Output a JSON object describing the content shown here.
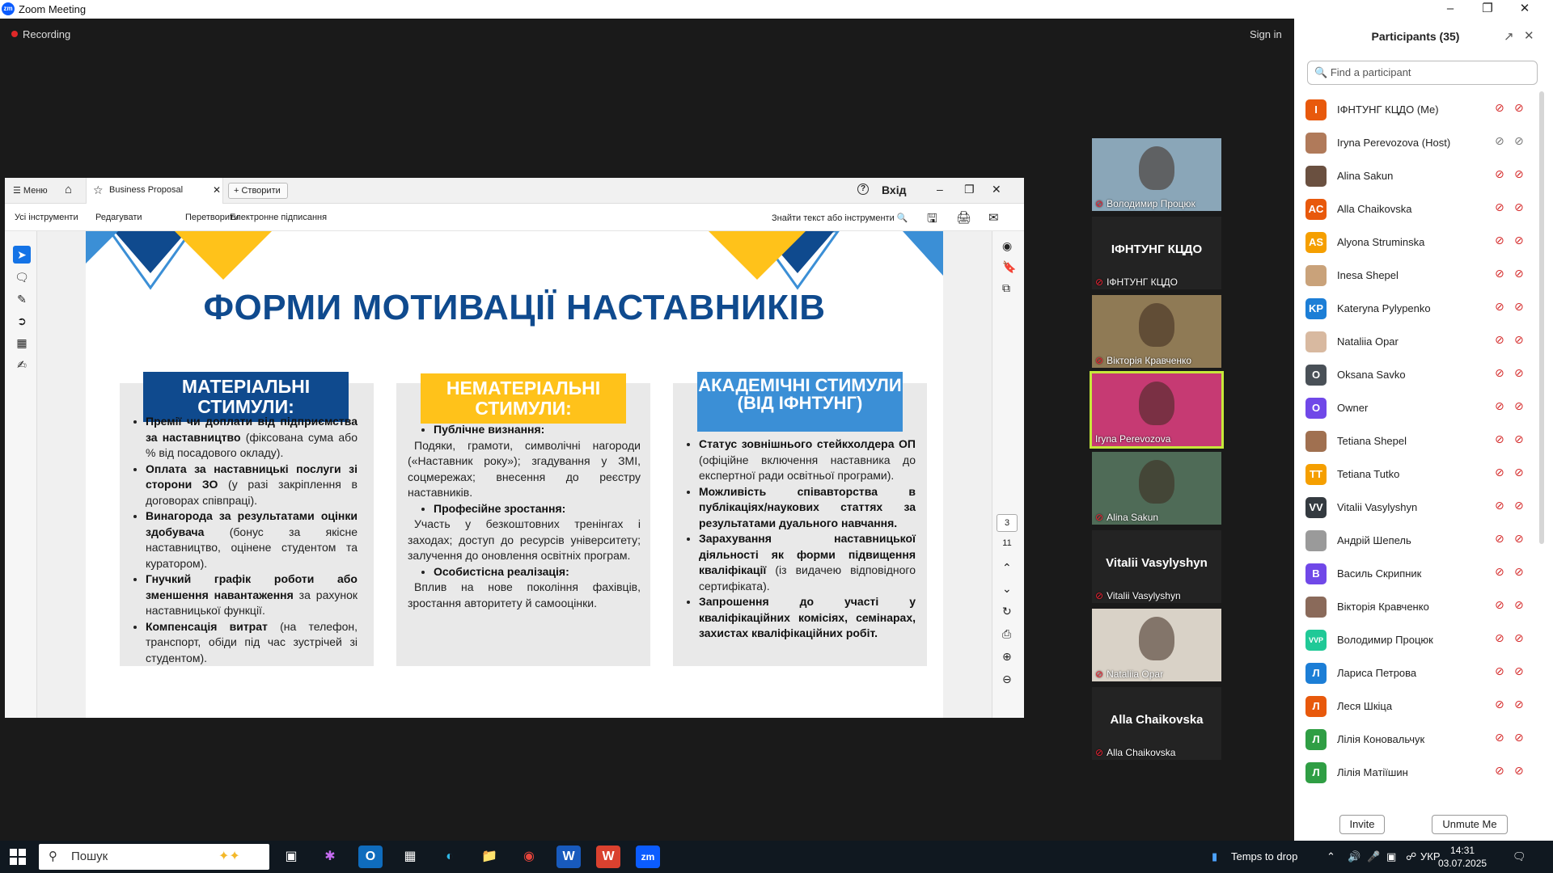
{
  "window": {
    "title": "Zoom Meeting",
    "logo": "zm"
  },
  "meeting": {
    "recording_label": "Recording",
    "sign_in": "Sign in"
  },
  "share": {
    "menu_label": "Меню",
    "tab_label": "Business Proposal",
    "create_label": "Створити",
    "login_label": "Вхід",
    "toolbar": {
      "all_tools": "Усі інструменти",
      "edit": "Редагувати",
      "convert": "Перетворити",
      "esign": "Електронне підписання",
      "search": "Знайти текст або інструменти"
    },
    "page_current": "3",
    "page_total": "11",
    "slide": {
      "title": "ФОРМИ МОТИВАЦІЇ НАСТАВНИКІВ",
      "colors": {
        "navy": "#0f4a8e",
        "yellow": "#ffc21a",
        "blue": "#3b8fd6",
        "title": "#0f4a8e"
      },
      "col1": {
        "head": "МАТЕРІАЛЬНІ СТИМУЛИ:",
        "items": [
          {
            "b": "Премії чи доплати від підприємства за наставництво",
            "t": " (фіксована сума або % від посадового окладу)."
          },
          {
            "b": "Оплата за наставницькі послуги зі сторони ЗО",
            "t": " (у разі закріплення в договорах співпраці)."
          },
          {
            "b": "Винагорода за результатами оцінки здобувача",
            "t": " (бонус за якісне наставництво, оцінене студентом та куратором)."
          },
          {
            "b": "Гнучкий графік роботи або зменшення навантаження",
            "t": " за рахунок наставницької функції."
          },
          {
            "b": "Компенсація витрат",
            "t": " (на телефон, транспорт, обіди під час зустрічей зі студентом)."
          }
        ]
      },
      "col2": {
        "head": "НЕМАТЕРІАЛЬНІ СТИМУЛИ:",
        "items": [
          {
            "b": "Публічне визнання:",
            "t": "Подяки, грамоти, символічні нагороди («Наставник року»); згадування у ЗМІ, соцмережах; внесення до реєстру наставників."
          },
          {
            "b": "Професійне зростання:",
            "t": "Участь у безкоштовних тренінгах і заходах; доступ до ресурсів університету; залучення до оновлення освітніх програм."
          },
          {
            "b": "Особистісна реалізація:",
            "t": "Вплив на нове покоління фахівців, зростання авторитету й самооцінки."
          }
        ]
      },
      "col3": {
        "head": "АКАДЕМІЧНІ СТИМУЛИ (ВІД ІФНТУНГ)",
        "items": [
          {
            "b": "Статус зовнішнього стейкхолдера ОП",
            "t": " (офіційне включення наставника до експертної ради освітньої програми)."
          },
          {
            "b": "Можливість співавторства в публікаціях/наукових статтях за результатами дуального навчання.",
            "t": ""
          },
          {
            "b": "Зарахування наставницької діяльності як форми підвищення кваліфікації",
            "t": " (із видачею відповідного сертифіката)."
          },
          {
            "b": "Запрошення до участі у кваліфікаційних комісіях, семінарах, захистах кваліфікаційних робіт.",
            "t": ""
          }
        ]
      }
    }
  },
  "video_tiles": [
    {
      "name": "Володимир Процюк",
      "big": "",
      "muted": true,
      "photo_bg": "#8aa6b8"
    },
    {
      "name": "ІФНТУНГ КЦДО",
      "big": "ІФНТУНГ КЦДО",
      "muted": true,
      "photo_bg": ""
    },
    {
      "name": "Вікторія Кравченко",
      "big": "",
      "muted": true,
      "photo_bg": "#8f7a55"
    },
    {
      "name": "Iryna Perevozova",
      "big": "",
      "muted": false,
      "photo_bg": "#c63a73"
    },
    {
      "name": "Alina Sakun",
      "big": "",
      "muted": true,
      "photo_bg": "#4f6b57"
    },
    {
      "name": "Vitalii Vasylyshyn",
      "big": "Vitalii Vasylyshyn",
      "muted": true,
      "photo_bg": ""
    },
    {
      "name": "Nataliia Opar",
      "big": "",
      "muted": true,
      "photo_bg": "#d9d2c7"
    },
    {
      "name": "Alla Chaikovska",
      "big": "Alla Chaikovska",
      "muted": true,
      "photo_bg": ""
    }
  ],
  "participants": {
    "header": "Participants (35)",
    "search_placeholder": "Find a participant",
    "invite": "Invite",
    "unmute_me": "Unmute Me",
    "list": [
      {
        "name": "ІФНТУНГ КЦДО (Me)",
        "initials": "І",
        "color": "#e8590c"
      },
      {
        "name": "Iryna Perevozova (Host)",
        "initials": "",
        "color": "#b07a5a"
      },
      {
        "name": "Alina Sakun",
        "initials": "",
        "color": "#6a5040"
      },
      {
        "name": "Alla Chaikovska",
        "initials": "AC",
        "color": "#e8590c"
      },
      {
        "name": "Alyona Struminska",
        "initials": "AS",
        "color": "#f59f00"
      },
      {
        "name": "Inesa Shepel",
        "initials": "",
        "color": "#c9a27a"
      },
      {
        "name": "Kateryna Pylypenko",
        "initials": "KP",
        "color": "#1c7ed6"
      },
      {
        "name": "Nataliia Opar",
        "initials": "",
        "color": "#d8b9a0"
      },
      {
        "name": "Oksana Savko",
        "initials": "O",
        "color": "#495057"
      },
      {
        "name": "Owner",
        "initials": "O",
        "color": "#7048e8"
      },
      {
        "name": "Tetiana Shepel",
        "initials": "",
        "color": "#a07050"
      },
      {
        "name": "Tetiana Tutko",
        "initials": "TT",
        "color": "#f59f00"
      },
      {
        "name": "Vitalii Vasylyshyn",
        "initials": "VV",
        "color": "#343a40"
      },
      {
        "name": "Андрій Шепель",
        "initials": "",
        "color": "#9a9a9a"
      },
      {
        "name": "Василь Скрипник",
        "initials": "В",
        "color": "#7048e8"
      },
      {
        "name": "Вікторія Кравченко",
        "initials": "",
        "color": "#8a6a5a"
      },
      {
        "name": "Володимир Процюк",
        "initials": "VVP",
        "color": "#20c997"
      },
      {
        "name": "Лариса Петрова",
        "initials": "Л",
        "color": "#1c7ed6"
      },
      {
        "name": "Леся Шкіца",
        "initials": "Л",
        "color": "#e8590c"
      },
      {
        "name": "Лілія Коновальчук",
        "initials": "Л",
        "color": "#2f9e44"
      },
      {
        "name": "Лілія Матіїшин",
        "initials": "Л",
        "color": "#2f9e44"
      }
    ]
  },
  "taskbar": {
    "search_placeholder": "Пошук",
    "tray_text": "Temps to drop",
    "language": "УКР",
    "time": "14:31",
    "date": "03.07.2025"
  }
}
